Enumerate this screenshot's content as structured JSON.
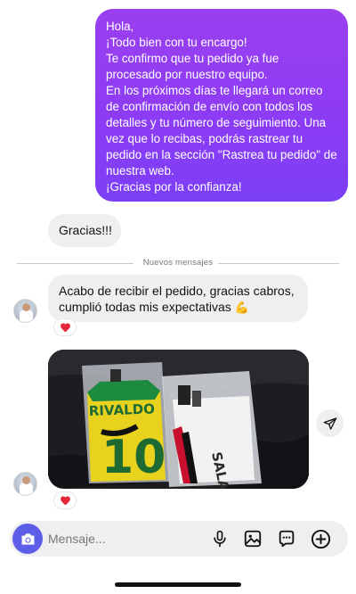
{
  "conversation": {
    "outgoing_message": {
      "lines": [
        "Hola,",
        "¡Todo bien con tu encargo!",
        "Te confirmo que tu pedido ya fue procesado por nuestro equipo.",
        "En los próximos días te llegará un correo de confirmación de envío con todos los detalles y tu número de seguimiento. Una vez que lo recibas, podrás rastrear tu pedido en la sección \"Rastrea tu pedido\" de nuestra web.",
        "¡Gracias por la confianza!"
      ]
    },
    "incoming_reply_1": "Gracias!!!",
    "divider_label": "Nuevos mensajes",
    "incoming_reply_2": {
      "text": "Acabo de recibir el pedido, gracias cabros, cumplió todas mis expectativas",
      "emoji": "💪",
      "reaction": "heart"
    },
    "photo_message": {
      "visible_text": [
        "RIVALDO",
        "10",
        "SALAH"
      ],
      "reaction": "heart"
    }
  },
  "composer": {
    "placeholder": "Mensaje...",
    "icons": [
      "camera-icon",
      "microphone-icon",
      "gallery-icon",
      "sticker-icon",
      "plus-icon"
    ]
  },
  "colors": {
    "outgoing_bubble_top": "#9b3ff0",
    "outgoing_bubble_bottom": "#7c3ff6",
    "incoming_bubble": "#efefef",
    "camera_button": "#5d5ee8",
    "heart": "#e5263b"
  }
}
